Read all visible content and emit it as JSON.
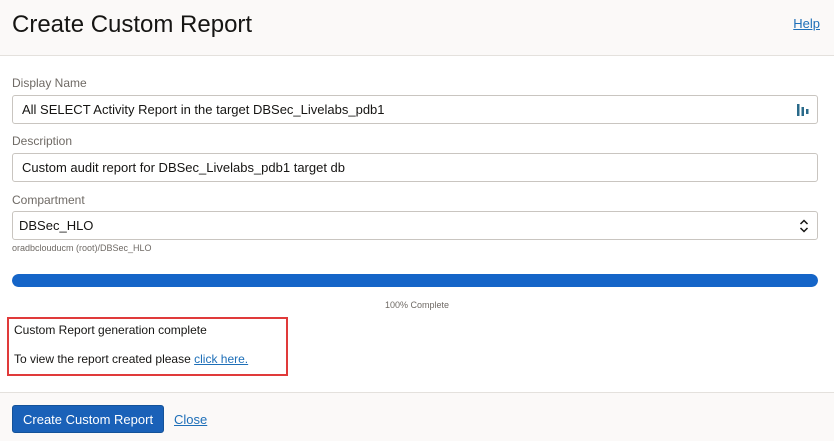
{
  "dialog": {
    "title": "Create Custom Report",
    "help_label": "Help"
  },
  "form": {
    "display_name": {
      "label": "Display Name",
      "value": "All SELECT Activity Report in the target DBSec_Livelabs_pdb1"
    },
    "description": {
      "label": "Description",
      "value": "Custom audit report for DBSec_Livelabs_pdb1 target db"
    },
    "compartment": {
      "label": "Compartment",
      "value": "DBSec_HLO",
      "path_hint": "oradbclouducm (root)/DBSec_HLO"
    }
  },
  "progress": {
    "percent": 100,
    "label": "100% Complete",
    "color": "#1565c8"
  },
  "result": {
    "status_text": "Custom Report generation complete",
    "view_prefix": "To view the report created please",
    "view_link": "click here.",
    "highlight_color": "#e03a3a"
  },
  "footer": {
    "create_button": "Create Custom Report",
    "close_link": "Close"
  },
  "icons": {
    "display_name_field": "autofill-icon",
    "compartment_select": "chevron-up-down-icon"
  }
}
